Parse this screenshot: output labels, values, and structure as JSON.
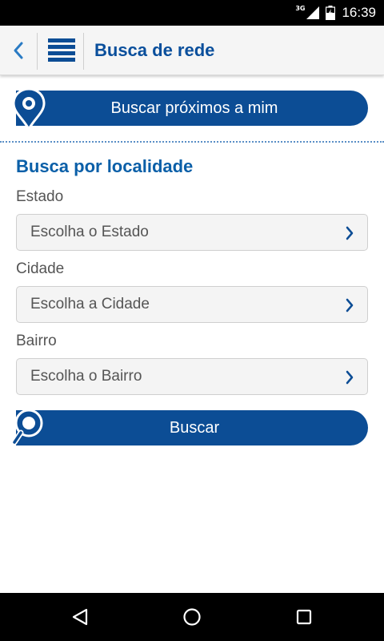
{
  "status_bar": {
    "network": "3G",
    "time": "16:39"
  },
  "app_bar": {
    "title": "Busca de rede"
  },
  "nearby_button": {
    "label": "Buscar próximos a mim"
  },
  "location_search": {
    "title": "Busca por localidade",
    "fields": [
      {
        "label": "Estado",
        "placeholder": "Escolha o Estado"
      },
      {
        "label": "Cidade",
        "placeholder": "Escolha a Cidade"
      },
      {
        "label": "Bairro",
        "placeholder": "Escolha o Bairro"
      }
    ]
  },
  "search_button": {
    "label": "Buscar"
  },
  "icons": {
    "back": "chevron-left-icon",
    "menu": "list-menu-icon",
    "nearby": "map-pin-icon",
    "search": "magnifier-icon",
    "select_arrow": "chevron-right-icon",
    "nav_back": "triangle-back-icon",
    "nav_home": "circle-home-icon",
    "nav_recents": "square-recents-icon"
  },
  "colors": {
    "brand_blue": "#0c4d95",
    "title_blue": "#0a4f9c",
    "section_blue": "#0a5fa8",
    "app_bar_bg": "#f5f5f5",
    "field_bg": "#f4f4f4"
  }
}
